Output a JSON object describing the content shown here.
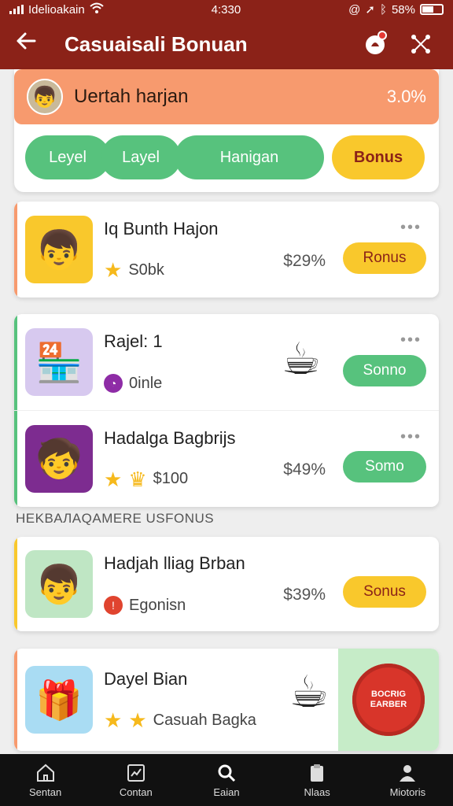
{
  "status_bar": {
    "carrier": "Idelioakain",
    "time": "4:330",
    "battery": "58%"
  },
  "header": {
    "title": "Casuaisali Bonuan",
    "colors": {
      "bar": "#8b2218"
    }
  },
  "profile": {
    "name": "Uertah harjan",
    "value": "3.0%"
  },
  "tabs": [
    {
      "label": "Leyel"
    },
    {
      "label": "Layel"
    },
    {
      "label": "Hanigan"
    },
    {
      "label": "Bonus"
    }
  ],
  "cards": [
    {
      "name": "Iq Bunth Hajon",
      "meta": "S0bk",
      "price": "$29%",
      "action": "Ronus",
      "more": "•••"
    },
    {
      "name": "Rajel: 1",
      "meta": "0inle",
      "action": "Sonno",
      "more": "•••"
    },
    {
      "name": "Hadalga Bagbrijs",
      "meta": "$100",
      "price": "$49%",
      "action": "Somo",
      "more": "•••"
    }
  ],
  "section_label": "HEKBAЛAQAMERE USFONUS",
  "featured": [
    {
      "name": "Hadjah lliag Brban",
      "meta": "Egonisn",
      "price": "$39%",
      "action": "Sonus"
    },
    {
      "name": "Dayel Bian",
      "meta": "Casuah Bagka",
      "badge": "BOCRIG EARBER"
    }
  ],
  "bottom_nav": [
    {
      "label": "Sentan",
      "icon": "home-icon"
    },
    {
      "label": "Contan",
      "icon": "chart-icon"
    },
    {
      "label": "Eaian",
      "icon": "search-icon"
    },
    {
      "label": "Nlaas",
      "icon": "clipboard-icon"
    },
    {
      "label": "Miotoris",
      "icon": "person-icon"
    }
  ]
}
